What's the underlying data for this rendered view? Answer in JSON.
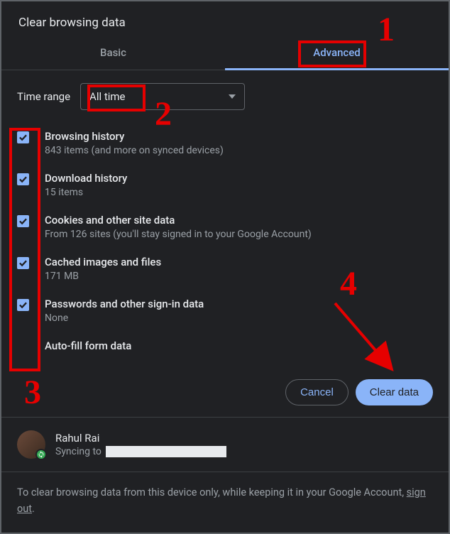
{
  "dialog": {
    "title": "Clear browsing data"
  },
  "tabs": {
    "basic": "Basic",
    "advanced": "Advanced",
    "active": "advanced"
  },
  "timeRange": {
    "label": "Time range",
    "value": "All time"
  },
  "items": [
    {
      "title": "Browsing history",
      "sub": "843 items (and more on synced devices)",
      "checked": true
    },
    {
      "title": "Download history",
      "sub": "15 items",
      "checked": true
    },
    {
      "title": "Cookies and other site data",
      "sub": "From 126 sites (you'll stay signed in to your Google Account)",
      "checked": true
    },
    {
      "title": "Cached images and files",
      "sub": "171 MB",
      "checked": true
    },
    {
      "title": "Passwords and other sign-in data",
      "sub": "None",
      "checked": true
    },
    {
      "title": "Auto-fill form data",
      "sub": "",
      "checked": true
    }
  ],
  "buttons": {
    "cancel": "Cancel",
    "clear": "Clear data"
  },
  "account": {
    "name": "Rahul Rai",
    "syncPrefix": "Syncing to"
  },
  "disclaimer": {
    "text": "To clear browsing data from this device only, while keeping it in your Google Account, ",
    "link": "sign out",
    "suffix": "."
  },
  "annotations": {
    "n1": "1",
    "n2": "2",
    "n3": "3",
    "n4": "4"
  }
}
